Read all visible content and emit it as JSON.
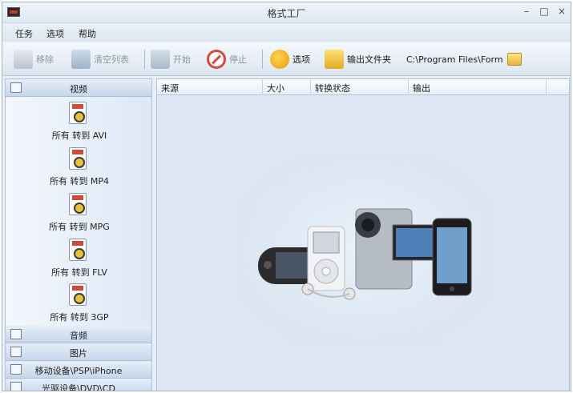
{
  "window": {
    "title": "格式工厂",
    "controls": {
      "minimize": "–",
      "maximize": "□",
      "close": "×"
    }
  },
  "menu": [
    "任务",
    "选项",
    "帮助"
  ],
  "toolbar": {
    "remove": "移除",
    "clear_list": "清空列表",
    "start": "开始",
    "stop": "停止",
    "options": "选项",
    "output_folder": "输出文件夹",
    "output_path": "C:\\Program Files\\Form"
  },
  "sidebar": {
    "categories": [
      "视频",
      "音频",
      "图片",
      "移动设备\\PSP\\iPhone",
      "光驱设备\\DVD\\CD"
    ],
    "video_formats": [
      {
        "badge": "AVI",
        "label": "所有 转到 AVI"
      },
      {
        "badge": "MP4",
        "label": "所有 转到 MP4"
      },
      {
        "badge": "MPG",
        "label": "所有 转到 MPG"
      },
      {
        "badge": "FLV",
        "label": "所有 转到 FLV"
      },
      {
        "badge": "3GP",
        "label": "所有 转到 3GP"
      }
    ]
  },
  "table": {
    "columns": [
      "来源",
      "大小",
      "转换状态",
      "输出"
    ]
  },
  "colors": {
    "accent": "#dde8f4",
    "sidebar_header": "#c6d6ea",
    "stop_red": "#d64a3c"
  }
}
